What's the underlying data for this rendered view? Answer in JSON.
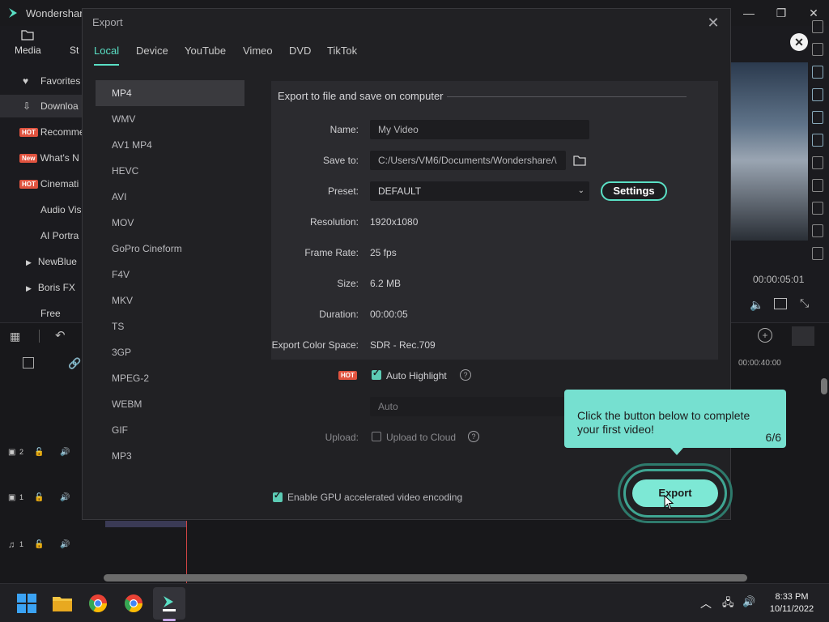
{
  "app": {
    "title": "Wondershare",
    "media_tabs": [
      "Media",
      "St"
    ],
    "sidebar": [
      {
        "icon": "heart-icon",
        "label": "Favorites",
        "badge": ""
      },
      {
        "icon": "download-icon",
        "label": "Downloa",
        "badge": ""
      },
      {
        "icon": "",
        "label": "Recomme",
        "badge": "HOT"
      },
      {
        "icon": "",
        "label": "What's N",
        "badge": "New"
      },
      {
        "icon": "",
        "label": "Cinemati",
        "badge": "HOT"
      },
      {
        "icon": "",
        "label": "Audio Vis",
        "badge": ""
      },
      {
        "icon": "",
        "label": "AI Portra",
        "badge": ""
      },
      {
        "icon": "caret-right-icon",
        "label": "NewBlue",
        "badge": ""
      },
      {
        "icon": "caret-right-icon",
        "label": "Boris FX",
        "badge": ""
      },
      {
        "icon": "",
        "label": "Free",
        "badge": ""
      }
    ],
    "preview_timecode": "00:00:05:01",
    "timeline_timecode": "00:00:40:00",
    "tracks": [
      "2",
      "1",
      "1"
    ]
  },
  "export_dialog": {
    "title": "Export",
    "tabs": [
      "Local",
      "Device",
      "YouTube",
      "Vimeo",
      "DVD",
      "TikTok"
    ],
    "active_tab": "Local",
    "formats": [
      "MP4",
      "WMV",
      "AV1 MP4",
      "HEVC",
      "AVI",
      "MOV",
      "GoPro Cineform",
      "F4V",
      "MKV",
      "TS",
      "3GP",
      "MPEG-2",
      "WEBM",
      "GIF",
      "MP3"
    ],
    "selected_format": "MP4",
    "heading": "Export to file and save on computer",
    "name_label": "Name:",
    "name_value": "My Video",
    "save_label": "Save to:",
    "save_value": "C:/Users/VM6/Documents/Wondershare/\\",
    "preset_label": "Preset:",
    "preset_value": "DEFAULT",
    "settings_button": "Settings",
    "resolution_label": "Resolution:",
    "resolution_value": "1920x1080",
    "framerate_label": "Frame Rate:",
    "framerate_value": "25 fps",
    "size_label": "Size:",
    "size_value": "6.2 MB",
    "duration_label": "Duration:",
    "duration_value": "00:00:05",
    "colorspace_label": "Export Color Space:",
    "colorspace_value": "SDR - Rec.709",
    "hot_badge": "HOT",
    "auto_highlight_label": "Auto Highlight",
    "auto_highlight_checked": true,
    "auto_value": "Auto",
    "upload_label": "Upload:",
    "upload_cloud_label": "Upload to Cloud",
    "upload_cloud_checked": false,
    "gpu_label": "Enable GPU accelerated video encoding",
    "gpu_checked": true,
    "export_button": "Export"
  },
  "tooltip": {
    "text": "Click the button below to complete your first video!",
    "step": "6/6"
  },
  "taskbar": {
    "time": "8:33 PM",
    "date": "10/11/2022"
  },
  "colors": {
    "accent": "#5ae0c5",
    "tooltip_bg": "#76e0d0",
    "hot_badge": "#e0533f",
    "new_badge": "#e0533f"
  }
}
